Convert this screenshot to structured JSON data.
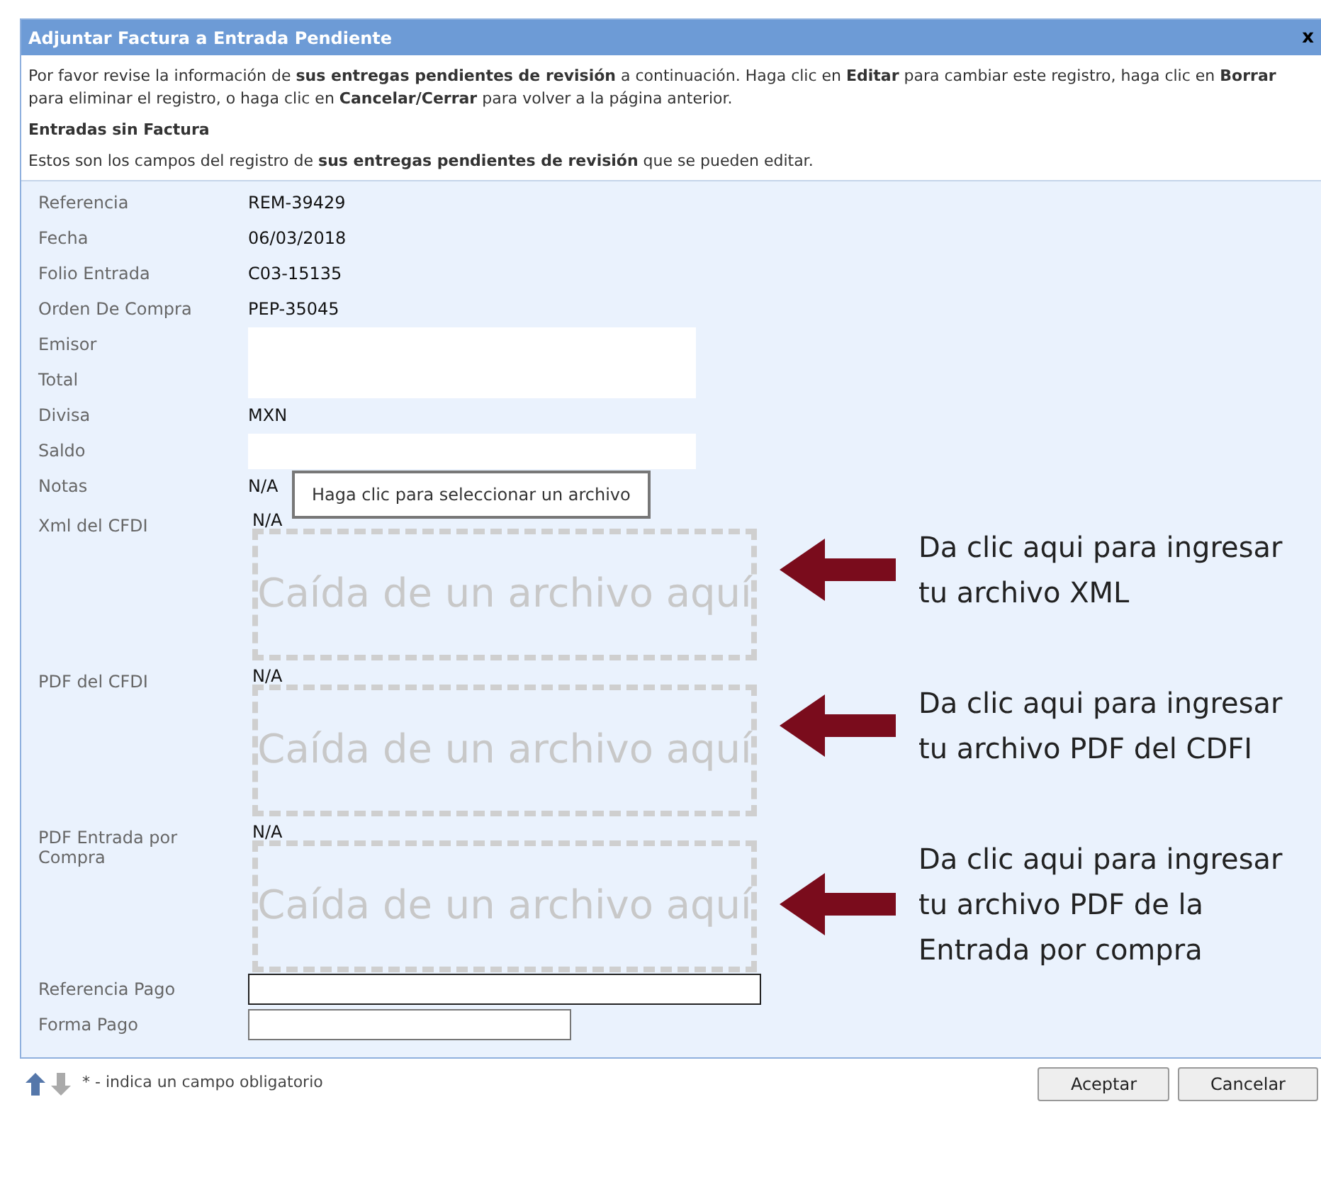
{
  "window": {
    "title": "Adjuntar Factura a Entrada Pendiente",
    "close": "x"
  },
  "intro": "Por favor revise la información de **sus entregas pendientes de revisión** a continuación. Haga clic en **Editar** para cambiar este registro, haga clic en **Borrar** para eliminar el registro, o haga clic en **Cancelar/Cerrar** para volver a la página anterior.",
  "section_title": "Entradas sin Factura",
  "section_note": "Estos son los campos del registro de **sus entregas pendientes de revisión** que se pueden editar.",
  "fields": [
    {
      "kind": "text",
      "label": "Referencia",
      "value": "REM-39429"
    },
    {
      "kind": "text",
      "label": "Fecha",
      "value": "06/03/2018"
    },
    {
      "kind": "text",
      "label": "Folio Entrada",
      "value": "C03-15135"
    },
    {
      "kind": "text",
      "label": "Orden De Compra",
      "value": "PEP-35045"
    },
    {
      "kind": "blank",
      "label": "Emisor"
    },
    {
      "kind": "blank",
      "label": "Total"
    },
    {
      "kind": "text",
      "label": "Divisa",
      "value": "MXN"
    },
    {
      "kind": "blank",
      "label": "Saldo"
    },
    {
      "kind": "text",
      "label": "Notas",
      "value": "N/A"
    },
    {
      "kind": "file",
      "label": "Xml del CFDI",
      "value": "N/A",
      "drop_text": "Caída de un archivo aquí",
      "note": "Da clic aqui para ingresar tu archivo XML"
    },
    {
      "kind": "file",
      "label": "PDF del CFDI",
      "value": "N/A",
      "drop_text": "Caída de un archivo aquí",
      "note": "Da clic aqui para ingresar tu archivo PDF del CDFI"
    },
    {
      "kind": "file",
      "label": "PDF Entrada por Compra",
      "value": "N/A",
      "drop_text": "Caída de un archivo aquí",
      "note": "Da clic aqui para ingresar tu archivo PDF de la Entrada por compra"
    },
    {
      "kind": "input",
      "label": "Referencia Pago",
      "focused": true,
      "wide": true
    },
    {
      "kind": "input",
      "label": "Forma Pago",
      "focused": false,
      "wide": false
    }
  ],
  "tooltip": "Haga clic para seleccionar un archivo",
  "legend": "* - indica un campo obligatorio",
  "buttons": [
    "Aceptar",
    "Cancelar"
  ]
}
